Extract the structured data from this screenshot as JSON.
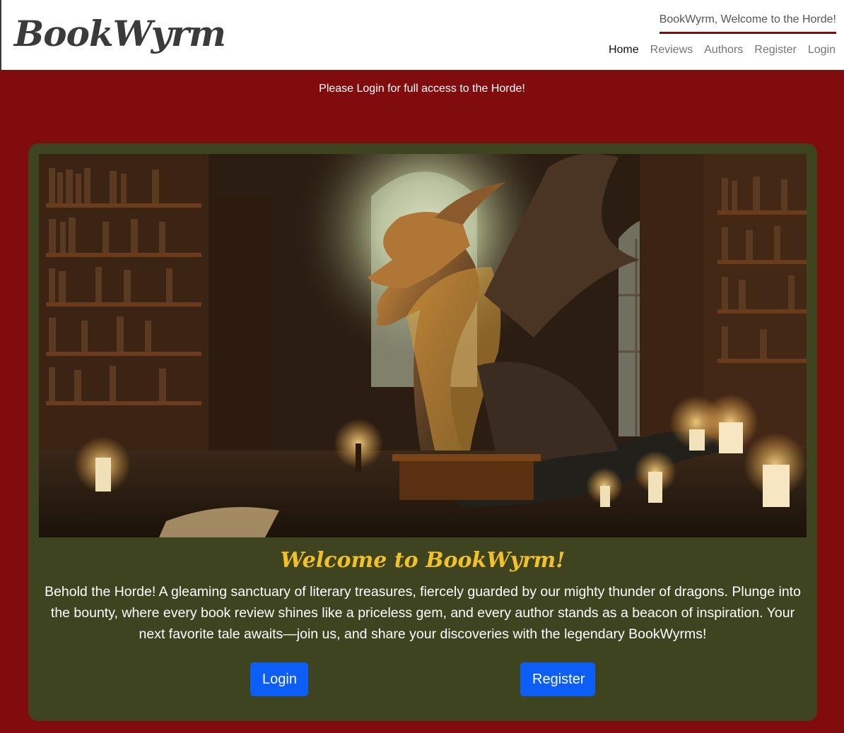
{
  "brand": "BookWyrm",
  "header": {
    "welcome": "BookWyrm, Welcome to the Horde!",
    "nav": [
      {
        "label": "Home",
        "active": true
      },
      {
        "label": "Reviews"
      },
      {
        "label": "Authors"
      },
      {
        "label": "Register"
      },
      {
        "label": "Login"
      }
    ]
  },
  "notice": "Please Login for full access to the Horde!",
  "card": {
    "image_alt": "Dragon in a candlelit library",
    "title": "Welcome to BookWyrm!",
    "text": "Behold the Horde! A gleaming sanctuary of literary treasures, fiercely guarded by our mighty thunder of dragons. Plunge into the bounty, where every book review shines like a priceless gem, and every author stands as a beacon of inspiration. Your next favorite tale awaits—join us, and share your discoveries with the legendary BookWyrms!",
    "login_label": "Login",
    "register_label": "Register"
  },
  "colors": {
    "page_bg": "#800c0e",
    "card_bg": "#3e4420",
    "title": "#f2c12a",
    "button": "#0d5ef7"
  }
}
